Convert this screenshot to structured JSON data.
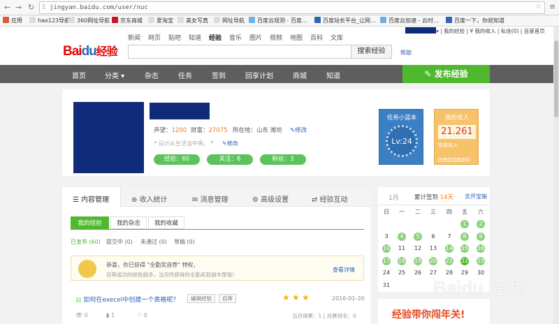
{
  "browser": {
    "url": "jingyan.baidu.com/user/nuc",
    "bookmarks": [
      "应用",
      "hao123导航",
      "360网址导航",
      "京东商城",
      "爱淘宝",
      "美女写真",
      "网址导航",
      "百度云观测 - 百度…",
      "百度站长平台_让网…",
      "百度云加速 - 云时…",
      "百度一下，你就知道"
    ]
  },
  "header": {
    "logo_bai": "Bai",
    "logo_du": "du",
    "logo_jy": "经验",
    "topnav": [
      "新闻",
      "网页",
      "贴吧",
      "知道",
      "经验",
      "音乐",
      "图片",
      "视频",
      "地图",
      "百科",
      "文库"
    ],
    "search_button": "搜索经验",
    "help": "帮助",
    "userbar": "▾ | 我的经验 | ¥ 我的收入 | 私信(0) | 百度首页"
  },
  "mainnav": {
    "items": [
      "首页",
      "分类 ▾",
      "杂志",
      "任务",
      "签到",
      "回享计划",
      "商城",
      "知道"
    ],
    "publish": "发布经验"
  },
  "profile": {
    "reputation_label": "声望：",
    "reputation": "1200",
    "wealth_label": "财富：",
    "wealth": "27075",
    "location_label": "所在地：",
    "location": "山东 潍坊",
    "edit": "修改",
    "motto": "设计从生活当中来。",
    "motto_edit": "修改",
    "pill_exp": "经验：60",
    "pill_follow": "关注：6",
    "pill_fans": "粉丝：3",
    "task_title": "任务小蓝本",
    "task_level": "Lv:24",
    "income_title": "我的收入",
    "income_value": "21.261",
    "income_label": "现金收入",
    "income_foot": "回馈您百度经验"
  },
  "tabs": {
    "items": [
      "内容管理",
      "收入统计",
      "消息管理",
      "高级设置",
      "经验互动"
    ],
    "subtabs": [
      "我的经验",
      "我的杂志",
      "我的收藏"
    ],
    "filters": [
      "已发布 (60)",
      "提交中 (0)",
      "未通过 (0)",
      "草稿 (0)"
    ],
    "notice_line1": "恭喜，你已获得 \"全勤奖自荐\" 特权，",
    "notice_line2": "自荐成功的经验越多，当月所获得的全勤奖就越丰厚哦！",
    "notice_link": "查看详情",
    "item_title": "如何在execel中创建一个表格呢？",
    "tag_edit": "编辑经验",
    "tag_self": "自荐",
    "item_date": "2016-01-20",
    "views": "0",
    "votes": "1",
    "likes": "0",
    "month_stats": "当月得票：1 | 月票排名：0"
  },
  "calendar": {
    "month": "1月",
    "sign_label": "累计签到",
    "sign_days": "14天",
    "help": "去开宝箱",
    "weekdays": [
      "日",
      "一",
      "二",
      "三",
      "四",
      "五",
      "六"
    ],
    "rows": [
      [
        "",
        "",
        "",
        "",
        "",
        "1",
        "2"
      ],
      [
        "3",
        "4",
        "5",
        "6",
        "7",
        "8",
        "9"
      ],
      [
        "10",
        "11",
        "12",
        "13",
        "14",
        "15",
        "16"
      ],
      [
        "17",
        "18",
        "19",
        "20",
        "21",
        "22",
        "23"
      ],
      [
        "24",
        "25",
        "26",
        "27",
        "28",
        "29",
        "30"
      ],
      [
        "31",
        "",
        "",
        "",
        "",
        "",
        ""
      ]
    ],
    "signed": [
      "1",
      "2",
      "4",
      "5",
      "8",
      "9",
      "10",
      "14",
      "15",
      "16",
      "17",
      "18",
      "19",
      "20",
      "21",
      "23"
    ],
    "today": "22"
  },
  "ad": {
    "text": "经验带你闯年关!"
  },
  "watermark": "Baidu 经验"
}
